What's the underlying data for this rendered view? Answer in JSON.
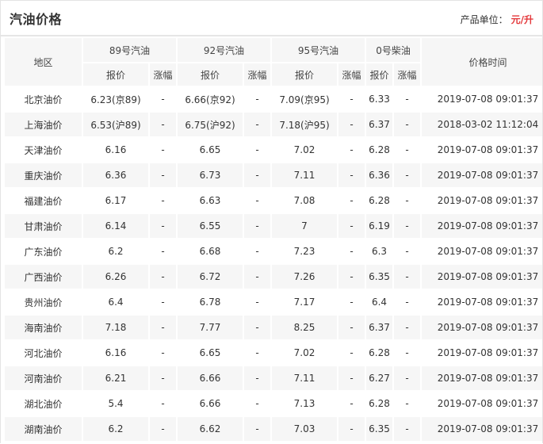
{
  "header": {
    "title": "汽油价格",
    "unit_label": "产品单位：",
    "unit_value": "元/升"
  },
  "table": {
    "region_header": "地区",
    "groups": [
      "89号汽油",
      "92号汽油",
      "95号汽油",
      "0号柴油"
    ],
    "price_header": "报价",
    "change_header": "涨幅",
    "time_header": "价格时间",
    "rows": [
      {
        "region": "北京油价",
        "p89": "6.23(京89)",
        "c89": "-",
        "p92": "6.66(京92)",
        "c92": "-",
        "p95": "7.09(京95)",
        "c95": "-",
        "p0": "6.33",
        "c0": "-",
        "time": "2019-07-08 09:01:37"
      },
      {
        "region": "上海油价",
        "p89": "6.53(沪89)",
        "c89": "-",
        "p92": "6.75(沪92)",
        "c92": "-",
        "p95": "7.18(沪95)",
        "c95": "-",
        "p0": "6.37",
        "c0": "-",
        "time": "2018-03-02 11:12:04"
      },
      {
        "region": "天津油价",
        "p89": "6.16",
        "c89": "-",
        "p92": "6.65",
        "c92": "-",
        "p95": "7.02",
        "c95": "-",
        "p0": "6.28",
        "c0": "-",
        "time": "2019-07-08 09:01:37"
      },
      {
        "region": "重庆油价",
        "p89": "6.36",
        "c89": "-",
        "p92": "6.73",
        "c92": "-",
        "p95": "7.11",
        "c95": "-",
        "p0": "6.36",
        "c0": "-",
        "time": "2019-07-08 09:01:37"
      },
      {
        "region": "福建油价",
        "p89": "6.17",
        "c89": "-",
        "p92": "6.63",
        "c92": "-",
        "p95": "7.08",
        "c95": "-",
        "p0": "6.28",
        "c0": "-",
        "time": "2019-07-08 09:01:37"
      },
      {
        "region": "甘肃油价",
        "p89": "6.14",
        "c89": "-",
        "p92": "6.55",
        "c92": "-",
        "p95": "7",
        "c95": "-",
        "p0": "6.19",
        "c0": "-",
        "time": "2019-07-08 09:01:37"
      },
      {
        "region": "广东油价",
        "p89": "6.2",
        "c89": "-",
        "p92": "6.68",
        "c92": "-",
        "p95": "7.23",
        "c95": "-",
        "p0": "6.3",
        "c0": "-",
        "time": "2019-07-08 09:01:37"
      },
      {
        "region": "广西油价",
        "p89": "6.26",
        "c89": "-",
        "p92": "6.72",
        "c92": "-",
        "p95": "7.26",
        "c95": "-",
        "p0": "6.35",
        "c0": "-",
        "time": "2019-07-08 09:01:37"
      },
      {
        "region": "贵州油价",
        "p89": "6.4",
        "c89": "-",
        "p92": "6.78",
        "c92": "-",
        "p95": "7.17",
        "c95": "-",
        "p0": "6.4",
        "c0": "-",
        "time": "2019-07-08 09:01:37"
      },
      {
        "region": "海南油价",
        "p89": "7.18",
        "c89": "-",
        "p92": "7.77",
        "c92": "-",
        "p95": "8.25",
        "c95": "-",
        "p0": "6.37",
        "c0": "-",
        "time": "2019-07-08 09:01:37"
      },
      {
        "region": "河北油价",
        "p89": "6.16",
        "c89": "-",
        "p92": "6.65",
        "c92": "-",
        "p95": "7.02",
        "c95": "-",
        "p0": "6.28",
        "c0": "-",
        "time": "2019-07-08 09:01:37"
      },
      {
        "region": "河南油价",
        "p89": "6.21",
        "c89": "-",
        "p92": "6.66",
        "c92": "-",
        "p95": "7.11",
        "c95": "-",
        "p0": "6.27",
        "c0": "-",
        "time": "2019-07-08 09:01:37"
      },
      {
        "region": "湖北油价",
        "p89": "5.4",
        "c89": "-",
        "p92": "6.66",
        "c92": "-",
        "p95": "7.13",
        "c95": "-",
        "p0": "6.28",
        "c0": "-",
        "time": "2019-07-08 09:01:37"
      },
      {
        "region": "湖南油价",
        "p89": "6.2",
        "c89": "-",
        "p92": "6.62",
        "c92": "-",
        "p95": "7.03",
        "c95": "-",
        "p0": "6.35",
        "c0": "-",
        "time": "2019-07-08 09:01:37"
      }
    ]
  },
  "colors": {
    "accent": "#e4393c",
    "header_bg": "#f6f6f6",
    "stripe_bg": "#f6f6f6",
    "border": "#e4e4e4"
  }
}
